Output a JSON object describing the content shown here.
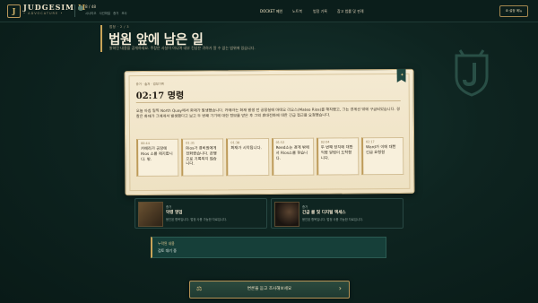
{
  "header": {
    "brand": "JUDGESIM",
    "brand_badge": "II",
    "brand_sub": "• ADVOCATURE •",
    "stat_main": "8 / 48",
    "stat_sub": [
      "시나리오",
      "사건파일",
      "증거 조사"
    ]
  },
  "nav": [
    "DOCKET 메인",
    "노트북",
    "법정 기록",
    "참고 법률 및 판례"
  ],
  "settings_label": "설정 메뉴",
  "page": {
    "eyebrow": "법정 · 2 / 3",
    "title": "법원 앞에 남은 일",
    "subtitle": "밝혀진 내용을 공개하세요. 주장은 사실이 아니며 내부 진상은 귀하가 알 수 없는 범위에 있습니다."
  },
  "case": {
    "label": "증거 · 출처 · 법정기록",
    "title": "02:17 명령",
    "body": "오늘 아침 일찍 North Quay에서 화재가 발생했습니다. 카메라는 화재 발생 전 공장실에 마테오 리오스(Mateo Rios)를 해지했고, 그는 경계선 밖에 구금되었습니다. 경찰은 화재가 그에게서 발생했다고 보고 두 번째 기기에 대한 정보를 받은 후 그의 휴대전화에 대한 긴급 접근을 요청했습니다.",
    "timeline": [
      {
        "time": "00:44",
        "text": "카메라가 공장에 Rios 소를 제지합니다. 밖."
      },
      {
        "time": "01:31",
        "text": "Rios가 경비원에게 전화했습니다. 관행으로 기록되지 않습니다."
      },
      {
        "time": "01:38",
        "text": "화재가 시작됩니다."
      },
      {
        "time": "01:52",
        "text": "Reed소는 경계 밖에서 Rios소를 찾습니다."
      },
      {
        "time": "02:04",
        "text": "두 번째 장치에 대한 익명 알림이 도착합니다."
      },
      {
        "time": "02:17",
        "text": "Ward가 이에 대한 긴급 요청함"
      }
    ]
  },
  "evidence": [
    {
      "tag": "증거",
      "name": "악령 영업",
      "desc": "봉인된 항목입니다. 법정 사용 가능한 자료입니다."
    },
    {
      "tag": "증거",
      "name": "긴급 콜 및 디지털 엑세스",
      "desc": "봉인된 항목입니다. 법정 사용 가능한 자료입니다."
    }
  ],
  "notice": {
    "label": "누락된 내용",
    "value": "검토 대기 중"
  },
  "action_label": "변론을 듣고 조사해보세요",
  "colors": {
    "accent": "#c9a458",
    "background": "#0e2420",
    "paper": "#f2e7cc"
  }
}
